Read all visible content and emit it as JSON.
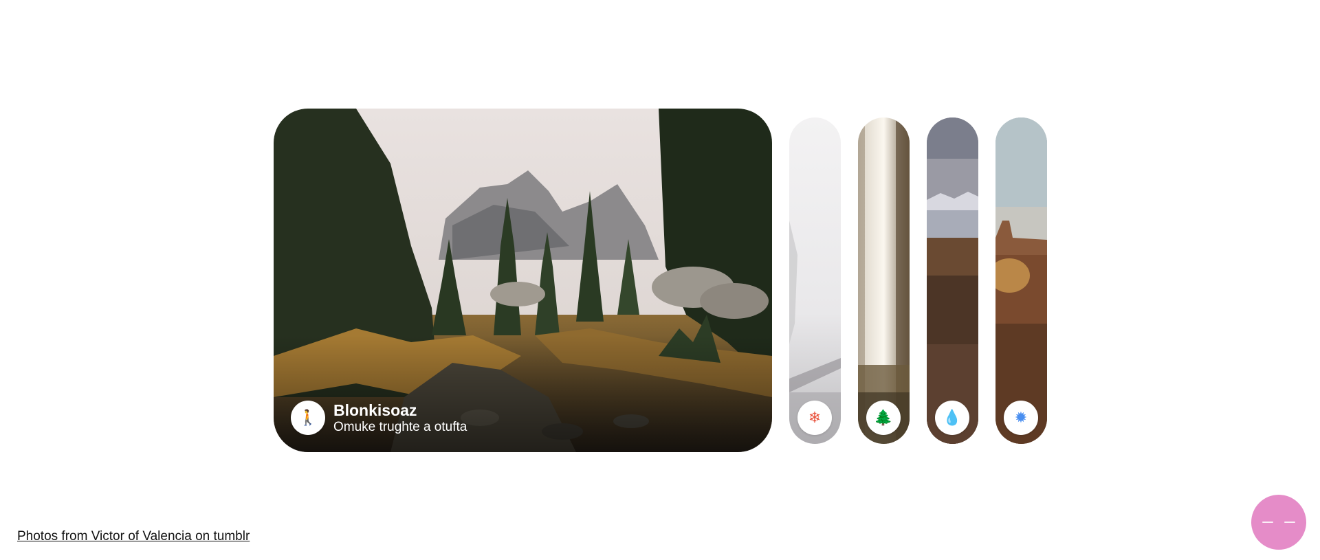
{
  "gallery": {
    "active": {
      "title": "Blonkisoaz",
      "subtitle": "Omuke trughte a otufta",
      "icon": "walking-icon",
      "icon_glyph": "🚶",
      "icon_color": "#e63946"
    },
    "collapsed": [
      {
        "icon": "snowflake-icon",
        "icon_glyph": "❄",
        "icon_color": "#e8503a"
      },
      {
        "icon": "tree-icon",
        "icon_glyph": "🌲",
        "icon_color": "#f2c23a"
      },
      {
        "icon": "water-drop-icon",
        "icon_glyph": "💧",
        "icon_color": "#2bbf5c"
      },
      {
        "icon": "sun-icon",
        "icon_glyph": "✹",
        "icon_color": "#4a8ff0"
      }
    ]
  },
  "footer": {
    "credit": "Photos from Victor of Valencia on tumblr"
  },
  "fab": {
    "color": "#e58cc8"
  }
}
